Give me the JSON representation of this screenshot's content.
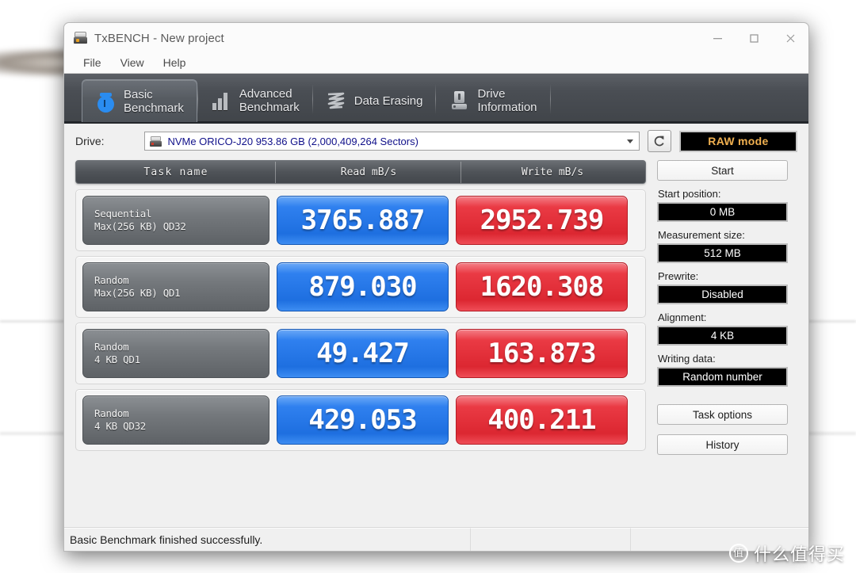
{
  "window": {
    "title": "TxBENCH - New project",
    "icon": "drive-icon",
    "controls": {
      "minimize": "minimize-icon",
      "maximize": "maximize-icon",
      "close": "close-icon"
    }
  },
  "menubar": {
    "items": [
      "File",
      "View",
      "Help"
    ]
  },
  "tabs": [
    {
      "label": "Basic\nBenchmark",
      "icon": "stopwatch-icon",
      "active": true
    },
    {
      "label": "Advanced\nBenchmark",
      "icon": "bar-chart-icon",
      "active": false
    },
    {
      "label": "Data Erasing",
      "icon": "erase-scribble-icon",
      "active": false
    },
    {
      "label": "Drive\nInformation",
      "icon": "drive-info-icon",
      "active": false
    }
  ],
  "drive": {
    "label": "Drive:",
    "value": "NVMe ORICO-J20  953.86 GB (2,000,409,264 Sectors)",
    "refresh_icon": "refresh-icon",
    "dropdown_icon": "chevron-down-icon",
    "raw_mode_label": "RAW mode"
  },
  "results": {
    "columns": [
      "Task name",
      "Read mB/s",
      "Write mB/s"
    ],
    "rows": [
      {
        "name_line1": "Sequential",
        "name_line2": "Max(256 KB) QD32",
        "read": "3765.887",
        "write": "2952.739"
      },
      {
        "name_line1": "Random",
        "name_line2": "Max(256 KB) QD1",
        "read": "879.030",
        "write": "1620.308"
      },
      {
        "name_line1": "Random",
        "name_line2": "4 KB QD1",
        "read": "49.427",
        "write": "163.873"
      },
      {
        "name_line1": "Random",
        "name_line2": "4 KB QD32",
        "read": "429.053",
        "write": "400.211"
      }
    ]
  },
  "side": {
    "start_label": "Start",
    "start_position_label": "Start position:",
    "start_position_value": "0 MB",
    "measurement_size_label": "Measurement size:",
    "measurement_size_value": "512 MB",
    "prewrite_label": "Prewrite:",
    "prewrite_value": "Disabled",
    "alignment_label": "Alignment:",
    "alignment_value": "4 KB",
    "writing_data_label": "Writing data:",
    "writing_data_value": "Random number",
    "task_options_label": "Task options",
    "history_label": "History"
  },
  "statusbar": {
    "message": "Basic Benchmark finished successfully."
  },
  "watermark": {
    "logo_text": "值",
    "text": "什么值得买"
  },
  "colors": {
    "read_accent": "#2f80ef",
    "write_accent": "#ea3a44",
    "raw_mode_text": "#f0b050",
    "drive_text": "#10108a",
    "tab_bar": "#4a4e54"
  },
  "chart_data": {
    "type": "table",
    "title": "TxBENCH Basic Benchmark results",
    "categories": [
      "Sequential Max(256 KB) QD32",
      "Random Max(256 KB) QD1",
      "Random 4 KB QD1",
      "Random 4 KB QD32"
    ],
    "series": [
      {
        "name": "Read mB/s",
        "values": [
          3765.887,
          879.03,
          49.427,
          429.053
        ]
      },
      {
        "name": "Write mB/s",
        "values": [
          2952.739,
          1620.308,
          163.873,
          400.211
        ]
      }
    ],
    "xlabel": "Task name",
    "ylabel": "mB/s",
    "legend_position": "header"
  }
}
